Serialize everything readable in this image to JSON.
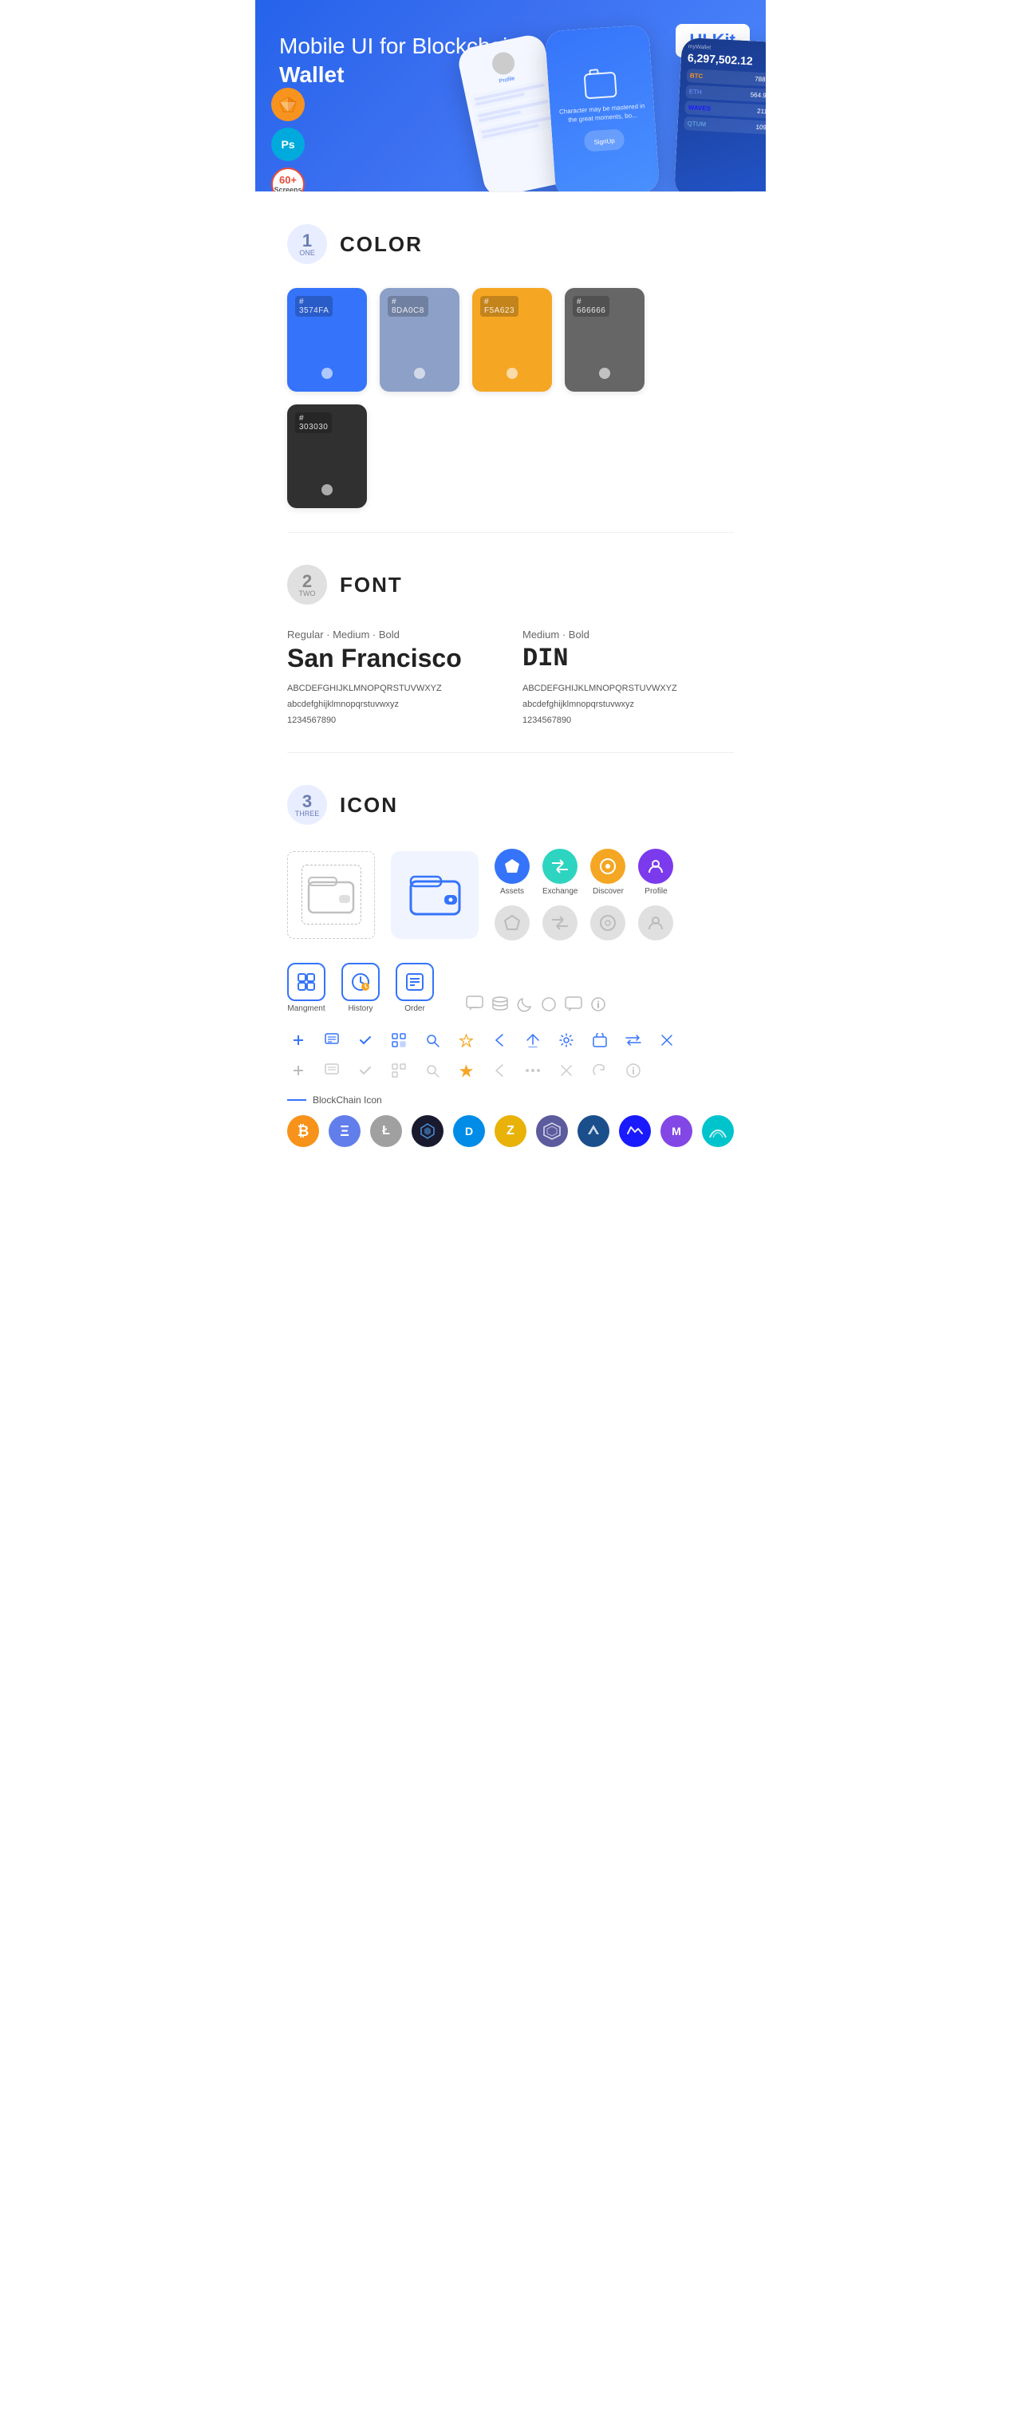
{
  "hero": {
    "title_normal": "Mobile UI for Blockchain ",
    "title_bold": "Wallet",
    "badge": "UI Kit",
    "badges": {
      "sketch": "S",
      "ps": "Ps",
      "screens": "60+\nScreens"
    }
  },
  "sections": {
    "color": {
      "number": "1",
      "word": "ONE",
      "title": "COLOR",
      "swatches": [
        {
          "hex": "#3574FA",
          "label": "3574FA"
        },
        {
          "hex": "#8DA0C8",
          "label": "8DA0C8"
        },
        {
          "hex": "#F5A623",
          "label": "F5A623"
        },
        {
          "hex": "#666666",
          "label": "666666"
        },
        {
          "hex": "#303030",
          "label": "303030"
        }
      ]
    },
    "font": {
      "number": "2",
      "word": "TWO",
      "title": "FONT",
      "fonts": [
        {
          "style": "Regular · Medium · Bold",
          "name": "San Francisco",
          "uppercase": "ABCDEFGHIJKLMNOPQRSTUVWXYZ",
          "lowercase": "abcdefghijklmnopqrstuvwxyz",
          "numbers": "1234567890"
        },
        {
          "style": "Medium · Bold",
          "name": "DIN",
          "uppercase": "ABCDEFGHIJKLMNOPQRSTUVWXYZ",
          "lowercase": "abcdefghijklmnopqrstuvwxyz",
          "numbers": "1234567890"
        }
      ]
    },
    "icon": {
      "number": "3",
      "word": "THREE",
      "title": "ICON",
      "nav_icons": [
        {
          "label": "Assets",
          "symbol": "◆"
        },
        {
          "label": "Exchange",
          "symbol": "⇄"
        },
        {
          "label": "Discover",
          "symbol": "●"
        },
        {
          "label": "Profile",
          "symbol": "⌒"
        }
      ],
      "bottom_icons": [
        {
          "label": "Mangment",
          "symbol": "▣"
        },
        {
          "label": "History",
          "symbol": "◷"
        },
        {
          "label": "Order",
          "symbol": "≡"
        }
      ],
      "small_icons": [
        "+",
        "⊞",
        "✓",
        "⊡",
        "⌕",
        "☆",
        "‹",
        "‹‹",
        "⚙",
        "⊡",
        "⇄",
        "✕"
      ],
      "blockchain_label": "BlockChain Icon",
      "crypto_coins": [
        {
          "symbol": "₿",
          "class": "crypto-btc",
          "name": "Bitcoin"
        },
        {
          "symbol": "Ξ",
          "class": "crypto-eth",
          "name": "Ethereum"
        },
        {
          "symbol": "Ł",
          "class": "crypto-ltc",
          "name": "Litecoin"
        },
        {
          "symbol": "◈",
          "class": "crypto-dark",
          "name": "PIVX"
        },
        {
          "symbol": "Đ",
          "class": "crypto-dash",
          "name": "Dash"
        },
        {
          "symbol": "ℤ",
          "class": "crypto-zcash",
          "name": "Zcash"
        },
        {
          "symbol": "⬡",
          "class": "crypto-grid",
          "name": "Grid"
        },
        {
          "symbol": "▲",
          "class": "crypto-stratis",
          "name": "Stratis"
        },
        {
          "symbol": "◈",
          "class": "crypto-waves",
          "name": "Waves"
        },
        {
          "symbol": "M",
          "class": "crypto-matic",
          "name": "Matic"
        },
        {
          "symbol": "~",
          "class": "crypto-sky",
          "name": "Skycoin"
        }
      ]
    }
  }
}
